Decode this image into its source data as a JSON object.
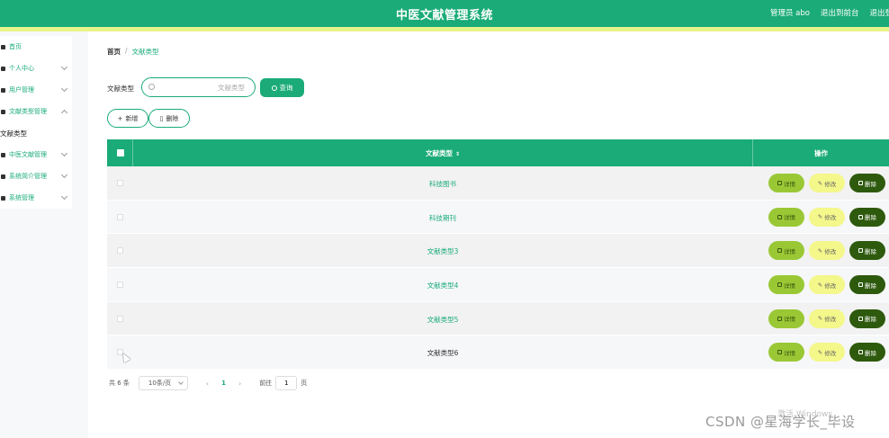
{
  "header": {
    "title": "中医文献管理系统",
    "user": "管理员 abo",
    "back_to_admin": "退出到前台",
    "logout": "退出登"
  },
  "sidebar": {
    "items": [
      {
        "label": "首页"
      },
      {
        "label": "个人中心"
      },
      {
        "label": "用户管理"
      },
      {
        "label": "文献类型管理"
      },
      {
        "label": "文献类型",
        "active": true
      },
      {
        "label": "中医文献管理"
      },
      {
        "label": "系统简介管理"
      },
      {
        "label": "系统管理"
      }
    ]
  },
  "breadcrumb": {
    "home": "首页",
    "separator": "/",
    "current": "文献类型"
  },
  "search": {
    "label": "文献类型",
    "placeholder": "文献类型",
    "button": "查询"
  },
  "actions": {
    "add": "新增",
    "delete": "删除"
  },
  "table": {
    "columns": {
      "type": "文献类型",
      "operation": "操作"
    },
    "rows": [
      {
        "type": "科技图书"
      },
      {
        "type": "科技期刊"
      },
      {
        "type": "文献类型3"
      },
      {
        "type": "文献类型4"
      },
      {
        "type": "文献类型5"
      },
      {
        "type": "文献类型6"
      }
    ],
    "row_actions": {
      "detail": "详情",
      "edit": "修改",
      "delete": "删除"
    }
  },
  "pagination": {
    "total": "共 6 条",
    "page_size": "10条/页",
    "current_page": "1",
    "goto_label": "前往",
    "goto_value": "1",
    "page_suffix": "页"
  },
  "overlay": {
    "watermark": "CSDN @星海学长_毕设",
    "windows_hint": "激活 Windows"
  },
  "colors": {
    "primary": "#1aab78",
    "stripe": "#e6f58a",
    "detail": "#9ac835",
    "edit": "#f4f78a",
    "delete": "#2e5a0e"
  }
}
